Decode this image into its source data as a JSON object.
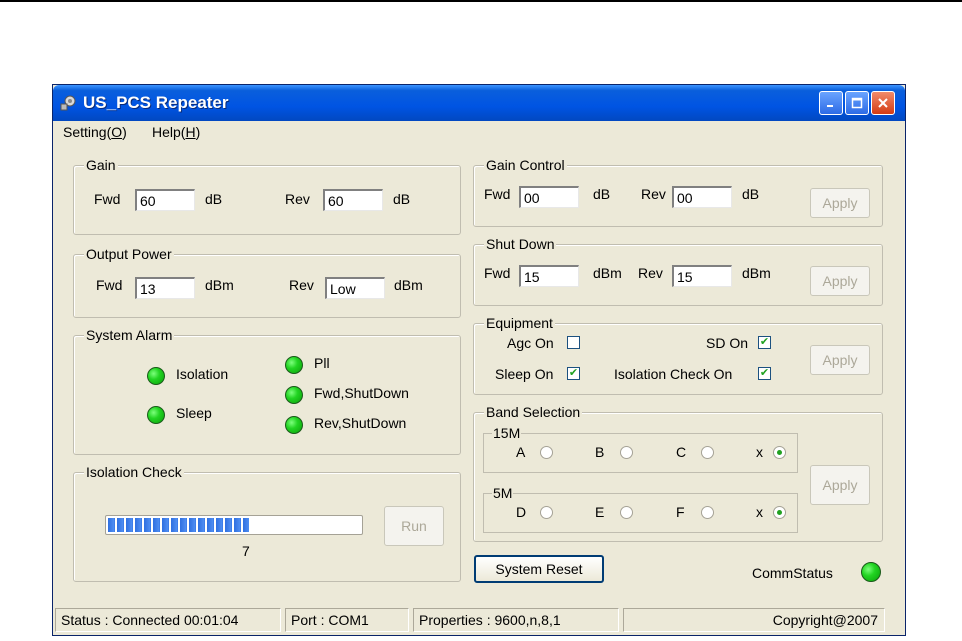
{
  "window": {
    "title": "US_PCS Repeater"
  },
  "menu": {
    "setting": {
      "text": "Setting(",
      "key": "O",
      "end": ")"
    },
    "help": {
      "text": "Help(",
      "key": "H",
      "end": ")"
    }
  },
  "gain": {
    "legend": "Gain",
    "fwd_label": "Fwd",
    "fwd_value": "60",
    "fwd_unit": "dB",
    "rev_label": "Rev",
    "rev_value": "60",
    "rev_unit": "dB"
  },
  "output_power": {
    "legend": "Output Power",
    "fwd_label": "Fwd",
    "fwd_value": "13",
    "fwd_unit": "dBm",
    "rev_label": "Rev",
    "rev_value": "Low",
    "rev_unit": "dBm"
  },
  "system_alarm": {
    "legend": "System Alarm",
    "isolation": "Isolation",
    "sleep": "Sleep",
    "pll": "Pll",
    "fwd_shutdown": "Fwd,ShutDown",
    "rev_shutdown": "Rev,ShutDown",
    "led_color": "#22d422"
  },
  "isolation_check": {
    "legend": "Isolation Check",
    "progress": 0.56,
    "value": "7",
    "run_label": "Run"
  },
  "gain_control": {
    "legend": "Gain Control",
    "fwd_label": "Fwd",
    "fwd_value": "00",
    "fwd_unit": "dB",
    "rev_label": "Rev",
    "rev_value": "00",
    "rev_unit": "dB",
    "apply_label": "Apply"
  },
  "shut_down": {
    "legend": "Shut Down",
    "fwd_label": "Fwd",
    "fwd_value": "15",
    "fwd_unit": "dBm",
    "rev_label": "Rev",
    "rev_value": "15",
    "rev_unit": "dBm",
    "apply_label": "Apply"
  },
  "equipment": {
    "legend": "Equipment",
    "agc_label": "Agc On",
    "agc_checked": false,
    "sd_label": "SD On",
    "sd_checked": true,
    "sleep_label": "Sleep On",
    "sleep_checked": true,
    "isolation_label": "Isolation Check On",
    "isolation_checked": true,
    "apply_label": "Apply"
  },
  "band_selection": {
    "legend": "Band Selection",
    "band15": {
      "legend": "15M",
      "opt_a": "A",
      "opt_b": "B",
      "opt_c": "C",
      "opt_x": "x",
      "selected": "x"
    },
    "band5": {
      "legend": "5M",
      "opt_d": "D",
      "opt_e": "E",
      "opt_f": "F",
      "opt_x": "x",
      "selected": "x"
    },
    "apply_label": "Apply"
  },
  "actions": {
    "system_reset_label": "System Reset",
    "comm_status_label": "CommStatus"
  },
  "statusbar": {
    "status": "Status : Connected 00:01:04",
    "port": "Port : COM1",
    "properties": "Properties : 9600,n,8,1",
    "copyright": "Copyright@2007"
  }
}
